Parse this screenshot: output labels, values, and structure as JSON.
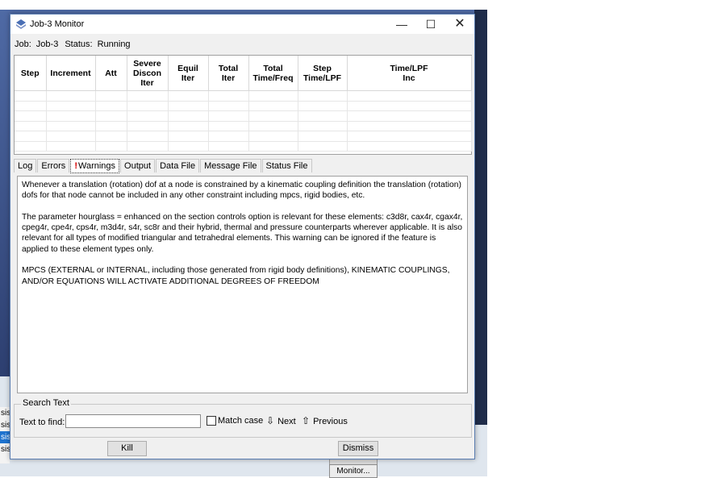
{
  "window": {
    "title": "Job-3 Monitor",
    "job_label": "Job:",
    "job_value": "Job-3",
    "status_label": "Status:",
    "status_value": "Running"
  },
  "table": {
    "headers": [
      [
        "Step"
      ],
      [
        "Increment"
      ],
      [
        "Att"
      ],
      [
        "Severe",
        "Discon",
        "Iter"
      ],
      [
        "Equil",
        "Iter"
      ],
      [
        "Total",
        "Iter"
      ],
      [
        "Total",
        "Time/Freq"
      ],
      [
        "Step",
        "Time/LPF"
      ],
      [
        "Time/LPF",
        "Inc"
      ]
    ],
    "rows": 6
  },
  "tabs": [
    {
      "label": "Log",
      "active": false
    },
    {
      "label": "Errors",
      "active": false
    },
    {
      "label": "Warnings",
      "active": true,
      "prefix": "!"
    },
    {
      "label": "Output",
      "active": false
    },
    {
      "label": "Data File",
      "active": false
    },
    {
      "label": "Message File",
      "active": false
    },
    {
      "label": "Status File",
      "active": false
    }
  ],
  "warnings": [
    "Whenever a translation (rotation) dof at a node is constrained by a kinematic coupling definition the translation (rotation) dofs for that node cannot be included in any other constraint including mpcs, rigid bodies, etc.",
    "The parameter hourglass = enhanced on the section controls option is relevant for these elements: c3d8r, cax4r, cgax4r, cpeg4r, cpe4r, cps4r, m3d4r, s4r, sc8r and their hybrid, thermal and pressure counterparts wherever applicable. It is also relevant for all types of modified triangular and tetrahedral elements. This warning can be ignored if the feature is applied to these element types only.",
    "MPCS (EXTERNAL or INTERNAL, including those generated from rigid body definitions), KINEMATIC COUPLINGS, AND/OR EQUATIONS WILL ACTIVATE ADDITIONAL DEGREES OF FREEDOM"
  ],
  "search": {
    "group_title": "Search Text",
    "find_label": "Text to find:",
    "find_value": "",
    "match_case_label": "Match case",
    "next_label": "Next",
    "previous_label": "Previous"
  },
  "buttons": {
    "kill": "Kill",
    "dismiss": "Dismiss"
  },
  "background": {
    "left_list": [
      "sis",
      "sis",
      "sis",
      "sis"
    ],
    "monitor_button": "Monitor..."
  },
  "colors": {
    "accent_selection": "#1e73cf",
    "warning_mark": "#d40000"
  }
}
